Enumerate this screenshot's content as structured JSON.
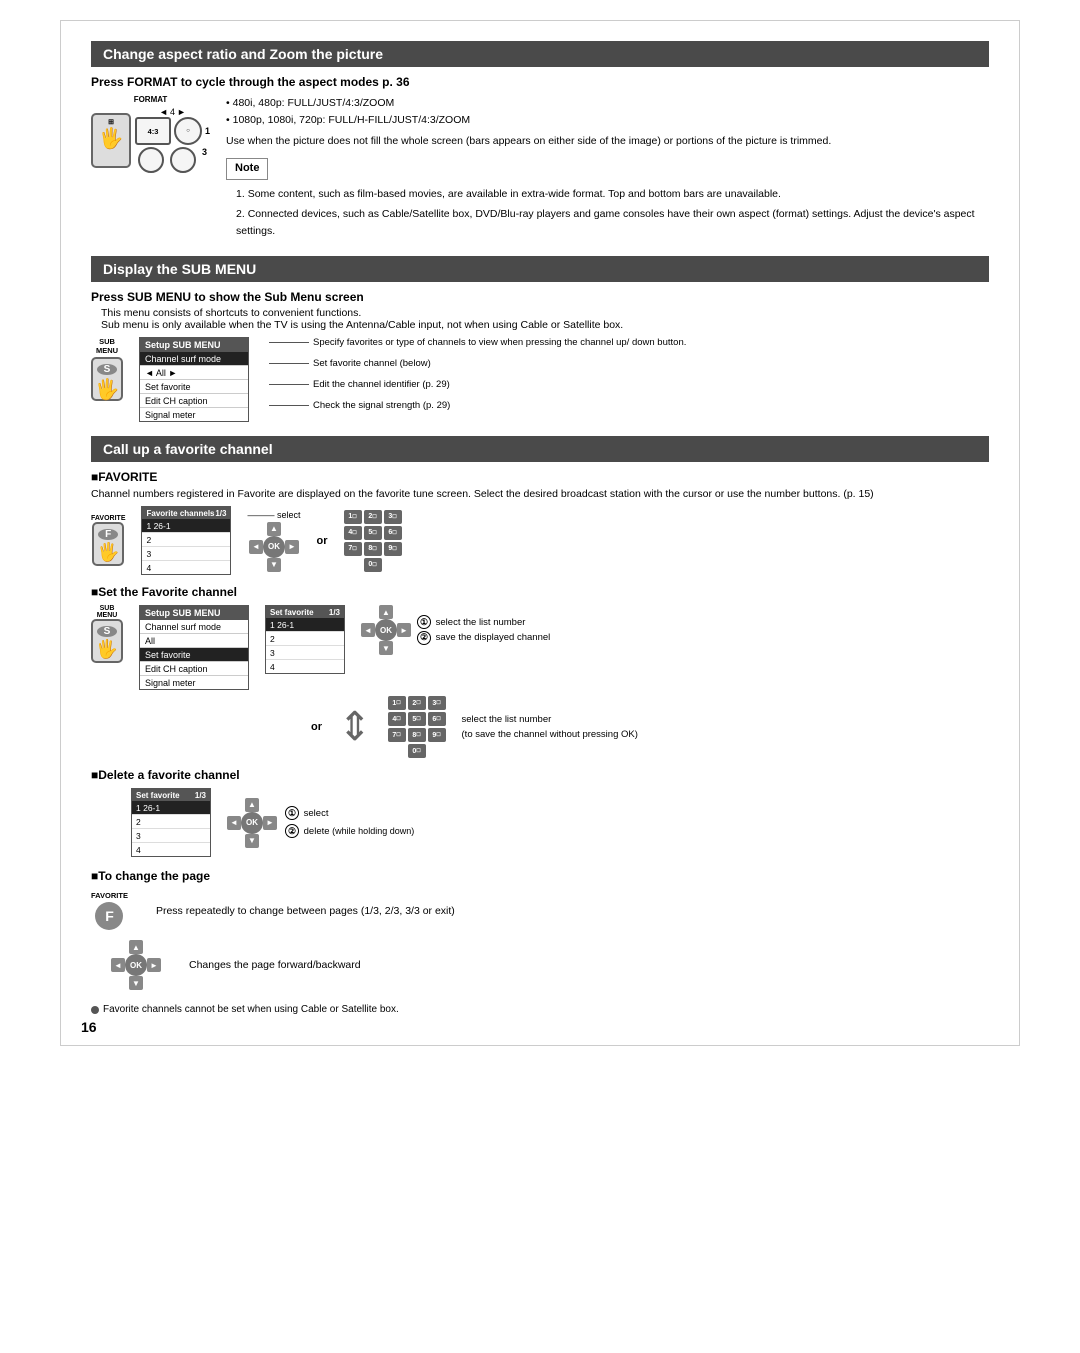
{
  "page": {
    "number": "16"
  },
  "sections": {
    "aspect_ratio": {
      "title": "Change aspect ratio and Zoom the picture",
      "subsection_title": "Press FORMAT to cycle through the aspect modes p. 36",
      "format_label": "FORMAT",
      "arrow_label": "4",
      "screen_label": "4:3",
      "bullets": [
        "480i, 480p: FULL/JUST/4:3/ZOOM",
        "1080p, 1080i, 720p: FULL/H-FILL/JUST/4:3/ZOOM"
      ],
      "use_when_text": "Use when the picture does not fill the whole screen (bars appears on either side of the image) or portions of the picture is trimmed.",
      "note_label": "Note",
      "notes": [
        "1. Some content, such as film-based movies, are available in extra-wide format. Top and bottom bars are unavailable.",
        "2. Connected devices, such as Cable/Satellite box, DVD/Blu-ray players and game consoles have their own aspect (format) settings. Adjust the device's aspect settings."
      ]
    },
    "sub_menu": {
      "title": "Display the SUB MENU",
      "subsection_title": "Press SUB MENU to show the Sub Menu screen",
      "desc1": "This menu consists of shortcuts to convenient functions.",
      "desc2": "Sub menu is only available when the TV is using the Antenna/Cable input, not when using Cable or Satellite box.",
      "sub_label": "SUB\nMENU",
      "menu": {
        "title": "Setup SUB MENU",
        "items": [
          {
            "label": "Channel surf mode",
            "highlight": true
          },
          {
            "label": "◄  All  ►",
            "highlight": false
          },
          {
            "label": "Set favorite",
            "highlight": false
          },
          {
            "label": "Edit CH caption",
            "highlight": false
          },
          {
            "label": "Signal meter",
            "highlight": false
          }
        ]
      },
      "desc_lines": [
        "Specify favorites or type of channels to view when pressing the channel up/ down button.",
        "Set favorite channel (below)",
        "Edit the channel identifier (p. 29)",
        "Check the signal strength (p. 29)"
      ]
    },
    "favorite_channel": {
      "title": "Call up a favorite channel",
      "favorite_label": "■FAVORITE",
      "favorite_desc": "Channel numbers registered in Favorite are displayed on the favorite tune screen. Select the desired broadcast station with the cursor or use the number buttons. (p. 15)",
      "fav_remote_label": "FAVORITE",
      "fav_box": {
        "title": "Favorite channels",
        "page": "1/3",
        "items": [
          {
            "num": "1",
            "ch": "26-1",
            "highlight": true
          },
          {
            "num": "2",
            "ch": "",
            "highlight": false
          },
          {
            "num": "3",
            "ch": "",
            "highlight": false
          },
          {
            "num": "4",
            "ch": "",
            "highlight": false
          }
        ]
      },
      "select_label": "select",
      "or_label": "or",
      "num_buttons": [
        [
          "1☐",
          "2☐",
          "3☐"
        ],
        [
          "4☐",
          "5☐",
          "6☐"
        ],
        [
          "7☐",
          "8☐",
          "9☐"
        ],
        [
          "0☐"
        ]
      ],
      "set_favorite": {
        "label": "■Set the Favorite channel",
        "sub_label": "SUB\nMENU",
        "menu": {
          "title": "Setup SUB MENU",
          "items": [
            {
              "label": "Channel surf mode",
              "highlight": false
            },
            {
              "label": "All",
              "highlight": false
            },
            {
              "label": "Set favorite",
              "highlight": true
            },
            {
              "label": "Edit CH caption",
              "highlight": false
            },
            {
              "label": "Signal meter",
              "highlight": false
            }
          ]
        },
        "set_fav_box": {
          "title": "Set favorite",
          "page": "1/3",
          "items": [
            {
              "num": "1",
              "ch": "26-1",
              "highlight": true
            },
            {
              "num": "2",
              "ch": "",
              "highlight": false
            },
            {
              "num": "3",
              "ch": "",
              "highlight": false
            },
            {
              "num": "4",
              "ch": "",
              "highlight": false
            }
          ]
        },
        "step1": "select the list number",
        "step2": "save the displayed channel",
        "or_label": "or",
        "select_list_text": "select the list number",
        "save_channel_text": "(to save the channel without pressing OK)",
        "num_buttons": [
          [
            "1☐",
            "2☐",
            "3☐"
          ],
          [
            "4☐",
            "5☐",
            "6☐"
          ],
          [
            "7☐",
            "8☐",
            "9☐"
          ],
          [
            "0☐"
          ]
        ]
      },
      "delete_favorite": {
        "label": "■Delete a favorite channel",
        "set_fav_box": {
          "title": "Set favorite",
          "page": "1/3",
          "items": [
            {
              "num": "1",
              "ch": "26-1",
              "highlight": true
            },
            {
              "num": "2",
              "ch": "",
              "highlight": false
            },
            {
              "num": "3",
              "ch": "",
              "highlight": false
            },
            {
              "num": "4",
              "ch": "",
              "highlight": false
            }
          ]
        },
        "step1": "select",
        "step2": "delete",
        "step2_note": "(while holding down)"
      },
      "change_page": {
        "label": "■To change the page",
        "fav_label": "FAVORITE",
        "desc1": "Press repeatedly to change between pages (1/3, 2/3, 3/3 or exit)",
        "desc2": "Changes the page forward/backward"
      }
    }
  },
  "footer": {
    "note": "Favorite channels cannot be set when using Cable or Satellite box."
  }
}
